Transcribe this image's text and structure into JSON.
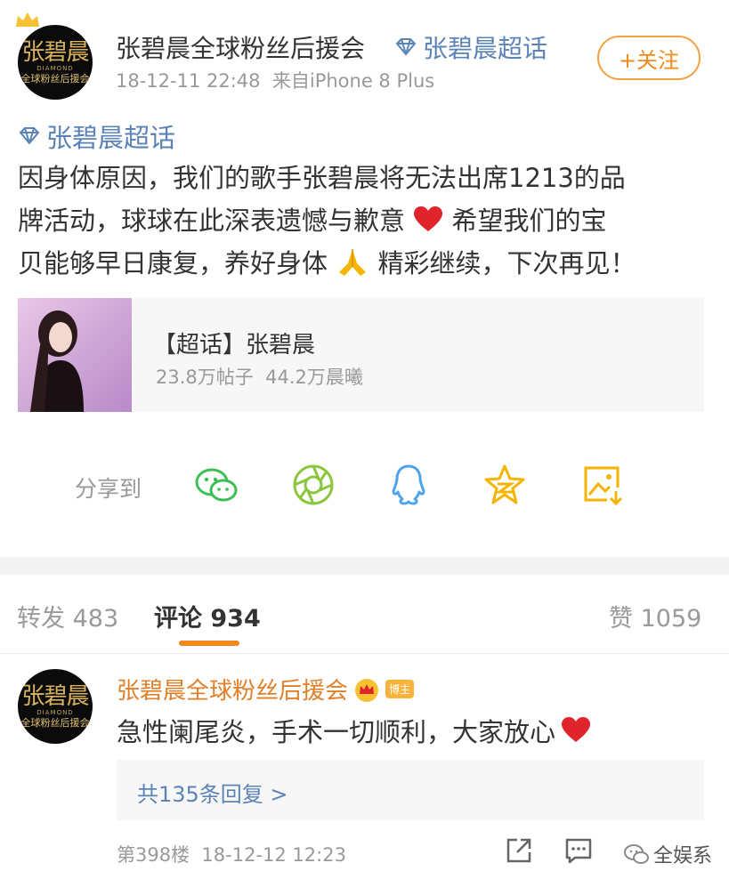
{
  "post": {
    "avatar_big": "张碧晨",
    "avatar_mid": "DIAMOND",
    "avatar_small": "全球粉丝后援会",
    "author": "张碧晨全球粉丝后援会",
    "topic_link": "张碧晨超话",
    "time": "18-12-11 22:48",
    "source": "来自iPhone 8 Plus",
    "follow_label": "+关注",
    "topic_tag": "张碧晨超话",
    "text_line1": "因身体原因，我们的歌手张碧晨将无法出席1213的品",
    "text_line2a": "牌活动，球球在此深表遗憾与歉意",
    "text_line2b": "希望我们的宝",
    "text_line3a": "贝能够早日康复，养好身体",
    "text_line3b": "精彩继续，下次再见！"
  },
  "card": {
    "title": "【超话】张碧晨",
    "stats": "23.8万帖子  44.2万晨曦"
  },
  "share": {
    "label": "分享到",
    "icons": [
      "wechat-icon",
      "moments-icon",
      "qq-icon",
      "qzone-icon",
      "save-image-icon"
    ]
  },
  "tabs": {
    "repost": "转发 483",
    "comment": "评论 934",
    "like": "赞 1059"
  },
  "comment": {
    "avatar_big": "张碧晨",
    "avatar_mid": "DIAMOND",
    "avatar_small": "全球粉丝后援会",
    "author": "张碧晨全球粉丝后援会",
    "badge": "博主",
    "text": "急性阑尾炎，手术一切顺利，大家放心",
    "replies": "共135条回复 >",
    "floor": "第398楼  18-12-12 12:23",
    "watermark": "全娱系"
  },
  "colors": {
    "accent": "#f08a1e",
    "link": "#5b83b6",
    "heart": "#e0242b",
    "wechat": "#3cbf55",
    "moments": "#8cc63f",
    "qq": "#4fa3e8",
    "qzone": "#f5b400",
    "save": "#f5b400"
  }
}
